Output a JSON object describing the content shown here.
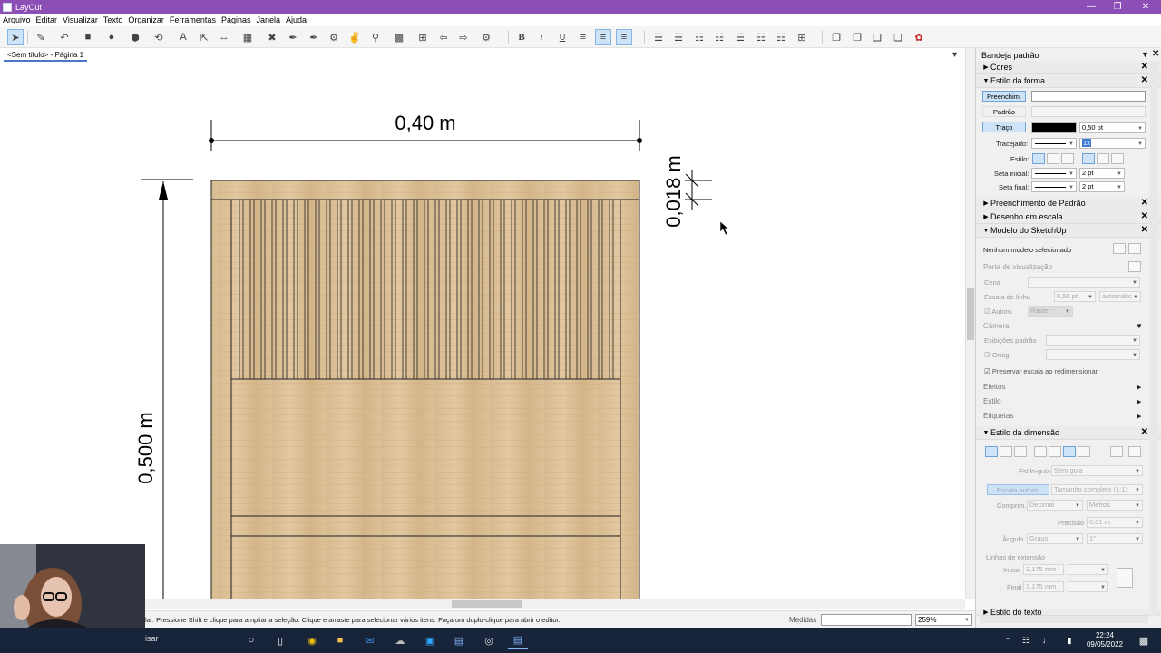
{
  "window": {
    "title": "LayOut"
  },
  "menu": [
    "Arquivo",
    "Editar",
    "Visualizar",
    "Texto",
    "Organizar",
    "Ferramentas",
    "Páginas",
    "Janela",
    "Ajuda"
  ],
  "toolbar": {
    "bold": "B",
    "italic": "i",
    "underline": "U"
  },
  "tab": {
    "label": "<Sem título> - Página 1"
  },
  "drawing": {
    "dim_width": "0,40 m",
    "dim_height": "0,500 m",
    "dim_small": "0,018 m"
  },
  "status": {
    "hint": "lar. Pressione Shift e clique para ampliar a seleção. Clique e arraste para selecionar vários itens. Faça um duplo-clique para abrir o editor.",
    "measures_label": "Medidas",
    "measures_value": "",
    "zoom": "259%"
  },
  "taskbar": {
    "search": "isar",
    "time": "22:24",
    "date": "09/05/2022"
  },
  "panel": {
    "title": "Bandeja padrão",
    "sections": {
      "cores": "Cores",
      "estilo_forma": "Estilo da forma",
      "preench_padrao": "Preenchimento de Padrão",
      "desenho_escala": "Desenho em escala",
      "modelo_sketchup": "Modelo do SketchUp",
      "estilo_dimensao": "Estilo da dimensão",
      "estilo_texto": "Estilo do texto"
    },
    "shape": {
      "preench": "Preenchim.",
      "padrao": "Padrão",
      "traco": "Traço",
      "traco_width": "0,50 pt",
      "tracejado": "Tracejado:",
      "tracejado_value": "1x",
      "estilo": "Estilo:",
      "seta_inicial": "Seta inicial:",
      "seta_inicial_value": "2 pt",
      "seta_final": "Seta final:",
      "seta_final_value": "2 pt"
    },
    "model": {
      "none": "Nenhum modelo selecionado",
      "viewport": "Porta de visualização",
      "cena": "Cena",
      "escala_linha": "Escala de linha",
      "escala_linha_value": "0,50 pt",
      "automatic": "automátic",
      "autom": "Autom.",
      "raster": "Raster",
      "camera": "Câmera",
      "exibicoes": "Exibições padrão",
      "orto": "Ortog.",
      "preservar": "Preservar escala ao redimensionar",
      "efeitos": "Efeitos",
      "estilo": "Estilo",
      "etiquetas": "Etiquetas"
    },
    "dimension": {
      "estilo_guia": "Estilo-guia:",
      "sem_guia": "Sem guia",
      "escala_autom": "Escala autom.",
      "tamanho": "Tamanho completo (1:1)",
      "comprim": "Comprim.",
      "decimal": "Decimal",
      "metros": "Metros",
      "precisao": "Precisão",
      "precisao_value": "0,01 m",
      "angulo": "Ângulo",
      "graus": "Graus",
      "grau_value": "1°",
      "linhas_ext": "Linhas de extensão",
      "inicio": "Início",
      "inicio_value": "3,175 mm",
      "final": "Final",
      "final_value": "3,175 mm"
    }
  }
}
